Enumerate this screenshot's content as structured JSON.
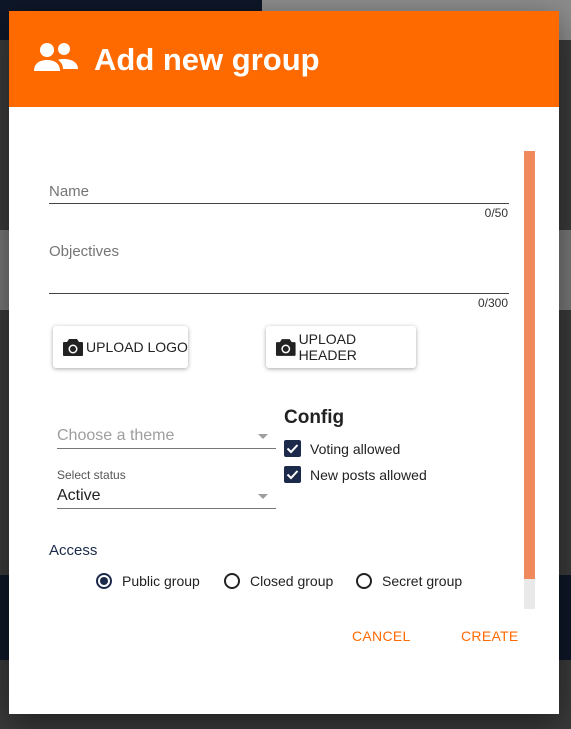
{
  "dialog": {
    "title": "Add new group",
    "header_icon": "group-icon",
    "accent_color": "#ff6a00"
  },
  "form": {
    "name": {
      "label": "Name",
      "value": "",
      "counter": "0/50"
    },
    "objectives": {
      "label": "Objectives",
      "value": "",
      "counter": "0/300"
    },
    "upload_logo": {
      "label": "UPLOAD LOGO",
      "icon": "camera-icon"
    },
    "upload_header": {
      "label": "UPLOAD HEADER",
      "icon": "camera-icon"
    },
    "theme": {
      "placeholder": "Choose a theme"
    },
    "status": {
      "label": "Select status",
      "value": "Active"
    }
  },
  "config": {
    "title": "Config",
    "options": [
      {
        "label": "Voting allowed",
        "checked": true
      },
      {
        "label": "New posts allowed",
        "checked": true
      }
    ]
  },
  "access": {
    "title": "Access",
    "options": [
      {
        "label": "Public group",
        "selected": true
      },
      {
        "label": "Closed group",
        "selected": false
      },
      {
        "label": "Secret group",
        "selected": false
      }
    ]
  },
  "actions": {
    "cancel": "CANCEL",
    "create": "CREATE"
  }
}
